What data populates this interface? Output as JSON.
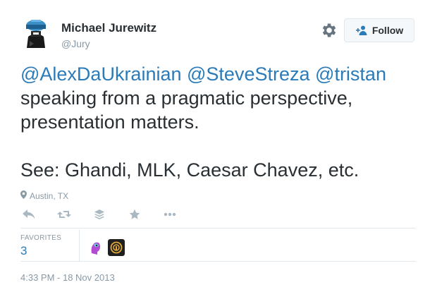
{
  "author": {
    "name": "Michael Jurewitz",
    "handle": "@Jury"
  },
  "follow_button": {
    "label": "Follow",
    "icon": "add-user-icon"
  },
  "settings": {
    "icon": "gear-icon"
  },
  "tweet": {
    "mentions": [
      "@AlexDaUkrainian",
      "@SteveStreza",
      "@tristan"
    ],
    "line2": "speaking from a pragmatic perspective,",
    "line3": "presentation matters.",
    "line5": "See: Ghandi, MLK, Caesar Chavez, etc."
  },
  "location": {
    "text": "Austin, TX",
    "icon": "location-pin-icon"
  },
  "actions": [
    {
      "name": "reply-icon"
    },
    {
      "name": "retweet-icon"
    },
    {
      "name": "stack-icon"
    },
    {
      "name": "favorite-star-icon"
    },
    {
      "name": "more-icon"
    }
  ],
  "favorites": {
    "label": "FAVORITES",
    "count": "3"
  },
  "timestamp": "4:33 PM - 18 Nov 2013",
  "colors": {
    "link": "#2b7bb9",
    "text": "#292f33",
    "muted": "#8899a6",
    "border": "#e1e8ed"
  }
}
